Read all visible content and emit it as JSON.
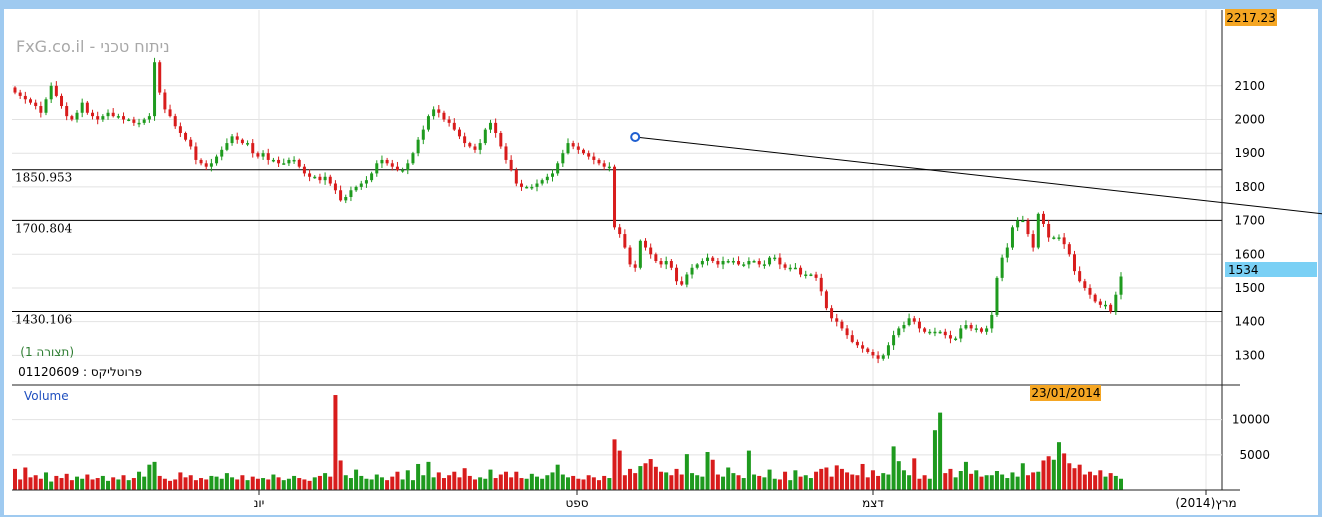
{
  "watermark": "FxG.co.il - ניתוח טכני",
  "chart_data": [
    {
      "type": "candlestick",
      "title": "",
      "y_ticks": [
        1300,
        1400,
        1500,
        1600,
        1700,
        1800,
        1900,
        2000,
        2100
      ],
      "ylim": [
        1215,
        2325
      ],
      "grid": true,
      "month_labels": [
        "יונ",
        "ספט",
        "דצמ",
        "מרץ(2014)"
      ],
      "top_price_badge": "2217.23",
      "last_price_badge": "1534",
      "date_badge": "23/01/2014",
      "horizontal_lines": [
        {
          "label": "1850.953",
          "value": 1850.953
        },
        {
          "label": "1700.804",
          "value": 1700.804
        },
        {
          "label": "1430.106",
          "value": 1430.106
        }
      ],
      "trendline": {
        "start": [
          120,
          1948
        ],
        "end": [
          280,
          1674
        ]
      },
      "annotations": {
        "pattern": "(תצורה 1)",
        "portfolio": "פרוטליקס : 01120609"
      },
      "colors": {
        "up": "#1e9a1e",
        "down": "#d81c1c",
        "badge": "#f5a623",
        "last_badge": "#7ad0f5"
      },
      "candles_close": [
        2080,
        2070,
        2060,
        2050,
        2040,
        2020,
        2060,
        2100,
        2070,
        2040,
        2010,
        2000,
        2020,
        2050,
        2020,
        2010,
        2000,
        2010,
        2020,
        2010,
        2010,
        2000,
        2000,
        1990,
        1990,
        2000,
        2010,
        2170,
        2080,
        2030,
        2010,
        1980,
        1960,
        1940,
        1920,
        1880,
        1870,
        1860,
        1870,
        1890,
        1910,
        1930,
        1950,
        1940,
        1930,
        1930,
        1900,
        1890,
        1900,
        1880,
        1880,
        1870,
        1870,
        1880,
        1880,
        1860,
        1840,
        1830,
        1830,
        1820,
        1830,
        1810,
        1790,
        1760,
        1770,
        1790,
        1800,
        1810,
        1820,
        1840,
        1870,
        1880,
        1870,
        1860,
        1850,
        1850,
        1870,
        1900,
        1940,
        1970,
        2010,
        2030,
        2020,
        2000,
        1990,
        1970,
        1950,
        1930,
        1920,
        1910,
        1930,
        1970,
        1990,
        1960,
        1920,
        1880,
        1850,
        1810,
        1800,
        1800,
        1800,
        1810,
        1820,
        1830,
        1840,
        1870,
        1900,
        1930,
        1920,
        1910,
        1900,
        1890,
        1880,
        1870,
        1860,
        1860,
        1680,
        1660,
        1620,
        1570,
        1560,
        1640,
        1620,
        1600,
        1580,
        1570,
        1580,
        1560,
        1520,
        1510,
        1540,
        1560,
        1570,
        1580,
        1590,
        1580,
        1570,
        1580,
        1580,
        1580,
        1570,
        1570,
        1580,
        1580,
        1570,
        1570,
        1590,
        1590,
        1570,
        1560,
        1560,
        1560,
        1540,
        1540,
        1540,
        1530,
        1490,
        1440,
        1410,
        1400,
        1380,
        1360,
        1340,
        1330,
        1320,
        1310,
        1300,
        1290,
        1300,
        1330,
        1360,
        1380,
        1390,
        1410,
        1400,
        1380,
        1370,
        1370,
        1370,
        1370,
        1360,
        1350,
        1350,
        1380,
        1390,
        1380,
        1380,
        1370,
        1380,
        1420,
        1530,
        1590,
        1620,
        1680,
        1700,
        1700,
        1660,
        1620,
        1720,
        1690,
        1650,
        1650,
        1650,
        1630,
        1600,
        1550,
        1520,
        1500,
        1480,
        1460,
        1450,
        1450,
        1430,
        1480,
        1534
      ],
      "volume": {
        "label": "Volume",
        "y_ticks": [
          5000,
          10000
        ],
        "ylim": [
          0,
          14500
        ],
        "values": [
          3000,
          1500,
          3200,
          1800,
          2100,
          1600,
          2500,
          1200,
          2000,
          1700,
          2300,
          1400,
          1900,
          1600,
          2200,
          1500,
          1700,
          2000,
          1300,
          1800,
          1500,
          2100,
          1400,
          1700,
          2600,
          1900,
          3600,
          4000,
          2000,
          1600,
          1300,
          1500,
          2500,
          1800,
          2100,
          1400,
          1700,
          1500,
          2000,
          1900,
          1600,
          2400,
          1800,
          1500,
          2100,
          1400,
          1900,
          1600,
          1700,
          1500,
          2200,
          1800,
          1400,
          1600,
          2000,
          1700,
          1500,
          1300,
          1800,
          2000,
          2400,
          1900,
          13500,
          4200,
          2100,
          1700,
          2900,
          2000,
          1600,
          1500,
          2200,
          1800,
          1400,
          1900,
          2600,
          1500,
          2800,
          1400,
          3700,
          2100,
          4000,
          1800,
          2500,
          1700,
          2100,
          2600,
          1800,
          3100,
          2000,
          1500,
          1800,
          1600,
          2900,
          1700,
          2200,
          2600,
          1800,
          2600,
          1700,
          1600,
          2300,
          1900,
          1600,
          2100,
          2500,
          3600,
          2200,
          1800,
          2000,
          1600,
          1500,
          2100,
          1800,
          1400,
          2000,
          1700,
          7200,
          5600,
          2100,
          3000,
          2400,
          3400,
          3800,
          4400,
          3300,
          2600,
          2500,
          2100,
          3000,
          2200,
          5100,
          2400,
          2100,
          1900,
          5400,
          4300,
          2200,
          1900,
          3200,
          2400,
          2100,
          1700,
          5600,
          2200,
          2000,
          1800,
          2900,
          1600,
          1500,
          2600,
          1400,
          2800,
          1900,
          2100,
          1700,
          2600,
          3000,
          3200,
          1900,
          3500,
          3000,
          2500,
          2200,
          2100,
          3700,
          1800,
          2800,
          2000,
          2400,
          2200,
          6200,
          4100,
          2800,
          2100,
          4500,
          1600,
          2100,
          1600,
          8500,
          11000,
          2400,
          3000,
          1800,
          2700,
          4000,
          2300,
          2800,
          1900,
          2100,
          2100,
          2700,
          2200,
          1700,
          2500,
          1900,
          3800,
          2100,
          2500,
          2600,
          4200,
          4800,
          4300,
          6800,
          5200,
          3800,
          3100,
          3600,
          2200,
          2600,
          2100,
          2800,
          1900,
          2400,
          2000,
          1600,
          2000,
          1600,
          1400,
          1800,
          1700,
          1500
        ]
      }
    }
  ]
}
